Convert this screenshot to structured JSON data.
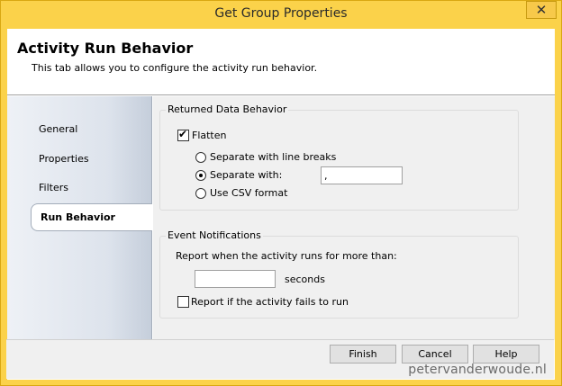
{
  "window": {
    "title": "Get Group Properties",
    "close_glyph": "✕"
  },
  "header": {
    "title": "Activity Run Behavior",
    "description": "This tab allows you to configure the activity run behavior."
  },
  "nav": {
    "items": [
      {
        "label": "General",
        "active": false
      },
      {
        "label": "Properties",
        "active": false
      },
      {
        "label": "Filters",
        "active": false
      },
      {
        "label": "Run Behavior",
        "active": true
      }
    ]
  },
  "returned_data": {
    "group_label": "Returned Data Behavior",
    "flatten_label": "Flatten",
    "flatten_checked": true,
    "options": [
      {
        "label": "Separate with line breaks",
        "selected": false
      },
      {
        "label": "Separate with:",
        "selected": true
      },
      {
        "label": "Use CSV format",
        "selected": false
      }
    ],
    "separator_value": ","
  },
  "event_notifications": {
    "group_label": "Event Notifications",
    "report_runs_label": "Report when the activity runs for more than:",
    "seconds_value": "",
    "seconds_label": "seconds",
    "report_fails_label": "Report if the activity fails to run",
    "report_fails_checked": false
  },
  "footer": {
    "finish_label": "Finish",
    "cancel_label": "Cancel",
    "help_label": "Help",
    "watermark": "petervanderwoude.nl"
  }
}
